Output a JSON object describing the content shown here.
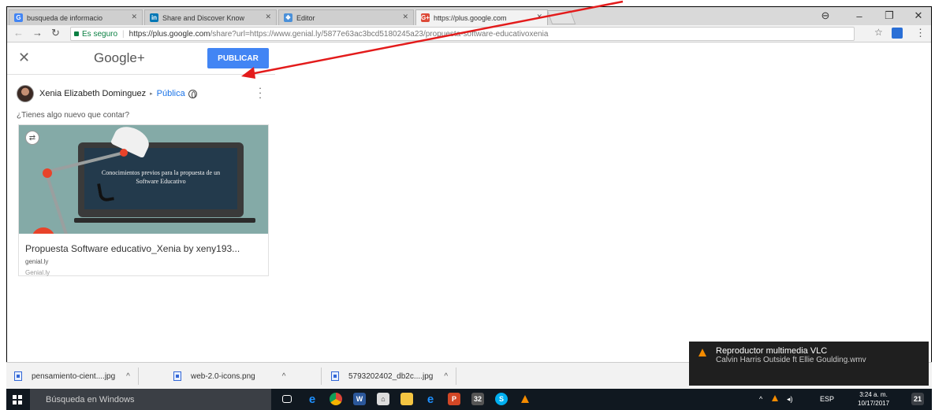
{
  "browser": {
    "tabs": [
      {
        "title": "busqueda de informacio",
        "favicon": "G"
      },
      {
        "title": "Share and Discover Know",
        "favicon": "in"
      },
      {
        "title": "Editor",
        "favicon": "❖"
      },
      {
        "title": "https://plus.google.com",
        "favicon": "G+"
      }
    ],
    "secure_label": "Es seguro",
    "url_host": "https://plus.google.com",
    "url_path": "/share?url=https://www.genial.ly/5877e63ac3bcd5180245a23/propuesta-software-educativoxenia"
  },
  "share": {
    "logo": "Google+",
    "publish_label": "PUBLICAR",
    "author_name": "Xenia Elizabeth Dominguez",
    "privacy": "Pública",
    "prompt": "¿Tienes algo nuevo que contar?"
  },
  "card": {
    "image_text": "Conocimientos previos para la propuesta de un Software Educativo",
    "title": "Propuesta Software educativo_Xenia by xeny193...",
    "domain": "genial.ly",
    "source": "Genial.ly"
  },
  "downloads": [
    {
      "name": "pensamiento-cient....jpg"
    },
    {
      "name": "web-2.0-icons.png"
    },
    {
      "name": "5793202402_db2c....jpg"
    }
  ],
  "notification": {
    "title": "Reproductor multimedia VLC",
    "body": "Calvin Harris   Outside ft Ellie Goulding.wmv"
  },
  "taskbar": {
    "search_placeholder": "Búsqueda en Windows",
    "language": "ESP",
    "time": "3:24 a. m.",
    "date": "10/17/2017",
    "badge_count": "21",
    "steam_badge": "32"
  },
  "colors": {
    "publish_button": "#4285f4",
    "annotation_arrow": "#e31b1b",
    "privacy_link": "#1a73e8"
  }
}
